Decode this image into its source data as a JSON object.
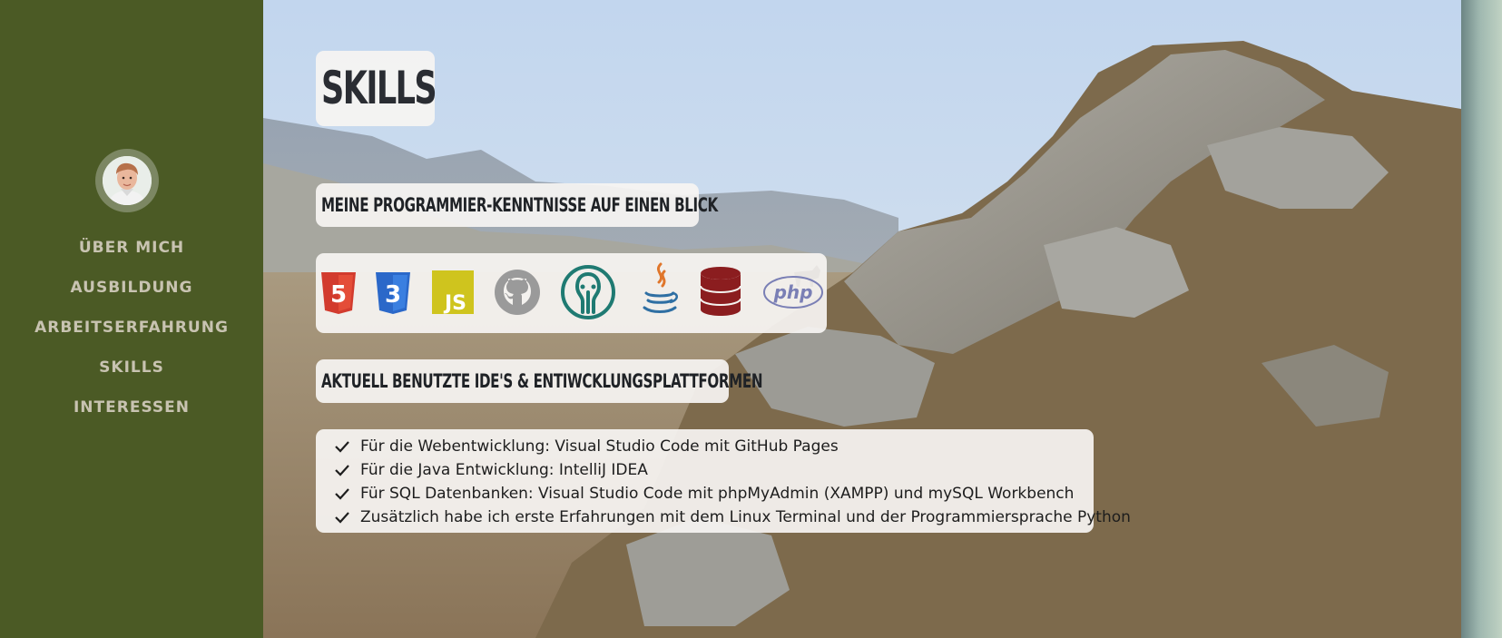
{
  "nav": {
    "items": [
      {
        "label": "ÜBER MICH"
      },
      {
        "label": "AUSBILDUNG"
      },
      {
        "label": "ARBEITSERFAHRUNG"
      },
      {
        "label": "SKILLS"
      },
      {
        "label": "INTERESSEN"
      }
    ]
  },
  "colors": {
    "sidebar": "#4b5a25",
    "nav_text": "#c8c3b1",
    "card": "#f6f4f2"
  },
  "page": {
    "title": "SKILLS",
    "section1": "MEINE PROGRAMMIER-KENNTNISSE AUF EINEN BLICK",
    "section2": "AKTUELL BENUTZTE IDE'S & ENTIWCKLUNGSPLATTFORMEN"
  },
  "skills": [
    {
      "icon": "html5-icon",
      "label": "5",
      "color": "#d23b2e"
    },
    {
      "icon": "css3-icon",
      "label": "3",
      "color": "#2b68c9"
    },
    {
      "icon": "javascript-icon",
      "label": "JS",
      "color": "#cfc41e"
    },
    {
      "icon": "github-icon",
      "color": "#9a9a9a"
    },
    {
      "icon": "gitkraken-icon",
      "color": "#1f7a72"
    },
    {
      "icon": "java-icon",
      "color": "#2f6fa3"
    },
    {
      "icon": "database-icon",
      "color": "#8b1d1f"
    },
    {
      "icon": "php-icon",
      "label": "php",
      "color": "#7a7fb5"
    }
  ],
  "ide_list": [
    "Für die Webentwicklung: Visual Studio Code mit GitHub Pages",
    "Für die Java Entwicklung: IntelliJ IDEA",
    "Für SQL Datenbanken: Visual Studio Code mit phpMyAdmin (XAMPP) und mySQL Workbench",
    "Zusätzlich habe ich erste Erfahrungen mit dem Linux Terminal und der Programmiersprache Python"
  ]
}
